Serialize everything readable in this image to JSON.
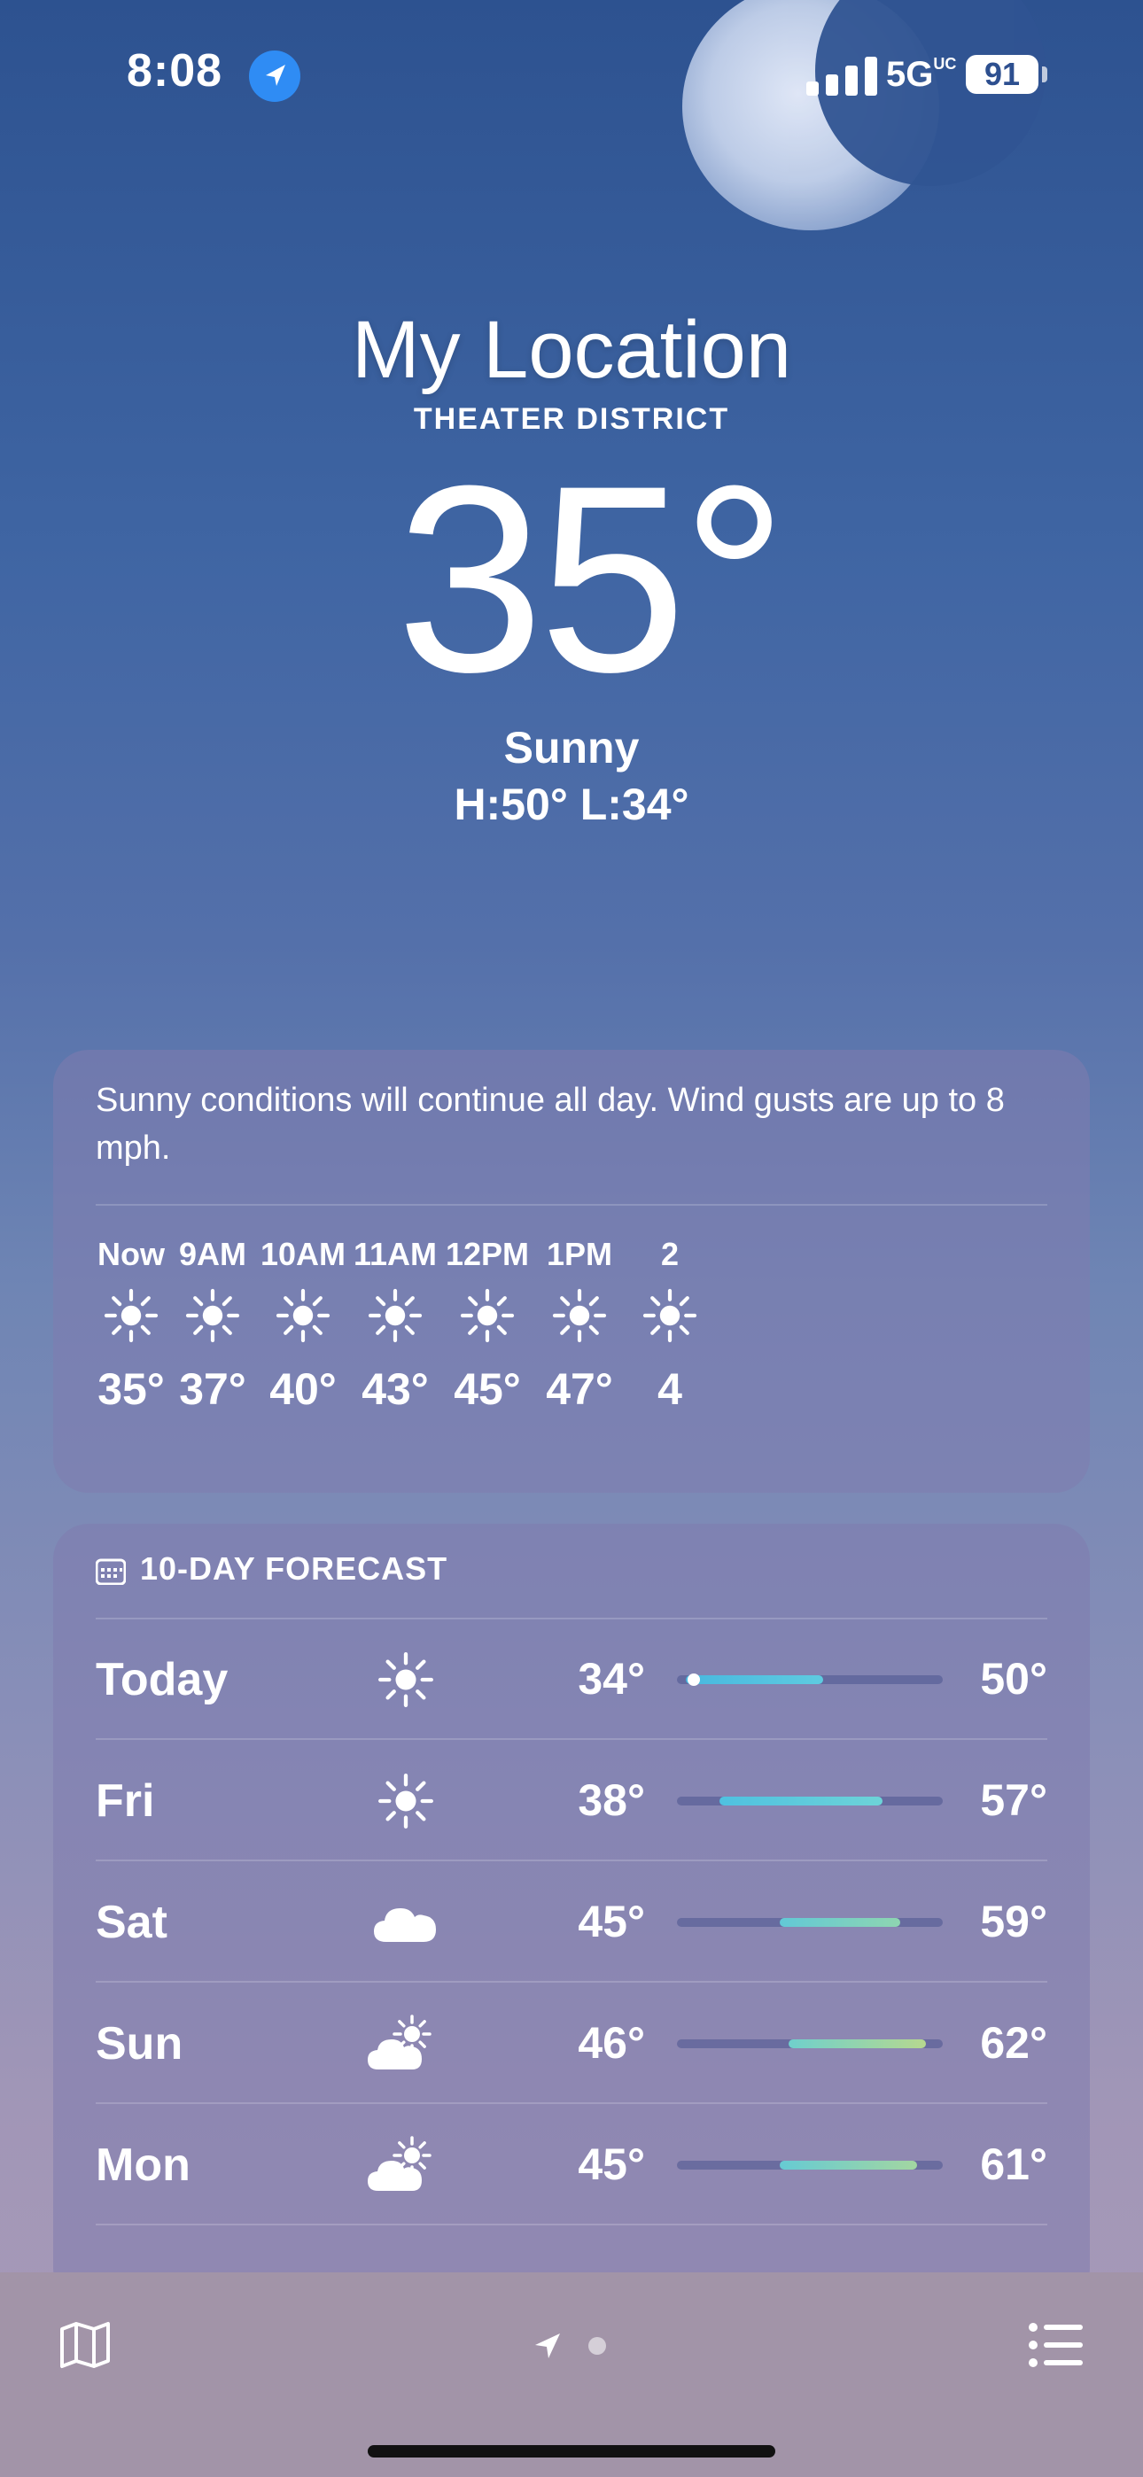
{
  "status_bar": {
    "time": "8:08",
    "network": "5G",
    "network_sup": "UC",
    "battery": "91"
  },
  "header": {
    "location_title": "My Location",
    "location_subtitle": "THEATER DISTRICT",
    "temperature": "35°",
    "condition": "Sunny",
    "high_low": "H:50°  L:34°"
  },
  "hourly": {
    "summary": "Sunny conditions will continue all day. Wind gusts are up to 8 mph.",
    "items": [
      {
        "label": "Now",
        "icon": "sun-icon",
        "temp": "35°"
      },
      {
        "label": "9AM",
        "icon": "sun-icon",
        "temp": "37°"
      },
      {
        "label": "10AM",
        "icon": "sun-icon",
        "temp": "40°"
      },
      {
        "label": "11AM",
        "icon": "sun-icon",
        "temp": "43°"
      },
      {
        "label": "12PM",
        "icon": "sun-icon",
        "temp": "45°"
      },
      {
        "label": "1PM",
        "icon": "sun-icon",
        "temp": "47°"
      },
      {
        "label": "2",
        "icon": "sun-icon",
        "temp": "4"
      }
    ]
  },
  "ten_day": {
    "title": "10-DAY FORECAST",
    "range_scale_min": 33,
    "range_scale_max": 64,
    "days": [
      {
        "day": "Today",
        "icon": "sun-icon",
        "low": "34°",
        "high": "50°",
        "low_value": 34,
        "high_value": 50,
        "colors": [
          "#48b8df",
          "#5ecbe0"
        ],
        "current_value": 35
      },
      {
        "day": "Fri",
        "icon": "sun-icon",
        "low": "38°",
        "high": "57°",
        "low_value": 38,
        "high_value": 57,
        "colors": [
          "#4fc1e0",
          "#6dd3d8"
        ]
      },
      {
        "day": "Sat",
        "icon": "cloud-icon",
        "low": "45°",
        "high": "59°",
        "low_value": 45,
        "high_value": 59,
        "colors": [
          "#62c9d6",
          "#8ed5b1"
        ]
      },
      {
        "day": "Sun",
        "icon": "partly-cloudy-icon",
        "low": "46°",
        "high": "62°",
        "low_value": 46,
        "high_value": 62,
        "colors": [
          "#6fd0cc",
          "#b6d88f"
        ]
      },
      {
        "day": "Mon",
        "icon": "partly-cloudy-icon",
        "low": "45°",
        "high": "61°",
        "low_value": 45,
        "high_value": 61,
        "colors": [
          "#66cbd3",
          "#a3d6a1"
        ]
      }
    ]
  },
  "bottom_bar": {
    "map_icon": "map-icon",
    "location_icon": "location-arrow-icon",
    "list_icon": "list-icon"
  }
}
